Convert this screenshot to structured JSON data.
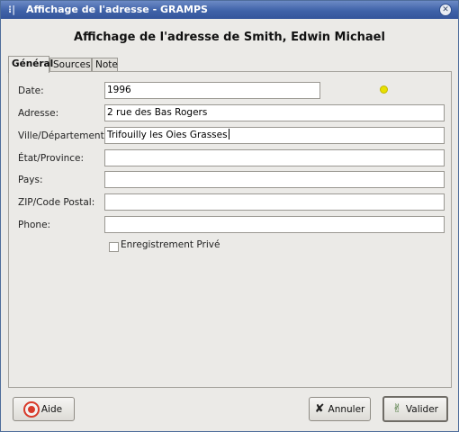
{
  "window": {
    "title": "Affichage de l'adresse - GRAMPS",
    "heading": "Affichage de l'adresse de Smith, Edwin Michael"
  },
  "tabs": [
    {
      "label": "Général",
      "active": true
    },
    {
      "label": "Sources",
      "active": false
    },
    {
      "label": "Note",
      "active": false
    }
  ],
  "form": {
    "date": {
      "label": "Date:",
      "value": "1996"
    },
    "address": {
      "label": "Adresse:",
      "value": "2 rue des Bas Rogers"
    },
    "city": {
      "label": "Ville/Département:",
      "value": "Trifouilly les Oies Grasses"
    },
    "state": {
      "label": "État/Province:",
      "value": ""
    },
    "country": {
      "label": "Pays:",
      "value": ""
    },
    "zip": {
      "label": "ZIP/Code Postal:",
      "value": ""
    },
    "phone": {
      "label": "Phone:",
      "value": ""
    },
    "private": {
      "label": "Enregistrement Privé",
      "checked": false
    }
  },
  "buttons": {
    "help": "Aide",
    "cancel": "Annuler",
    "ok": "Valider"
  },
  "colors": {
    "titlebar": "#3f62a8",
    "date_status": "#e8e000",
    "background": "#ebeae7"
  }
}
